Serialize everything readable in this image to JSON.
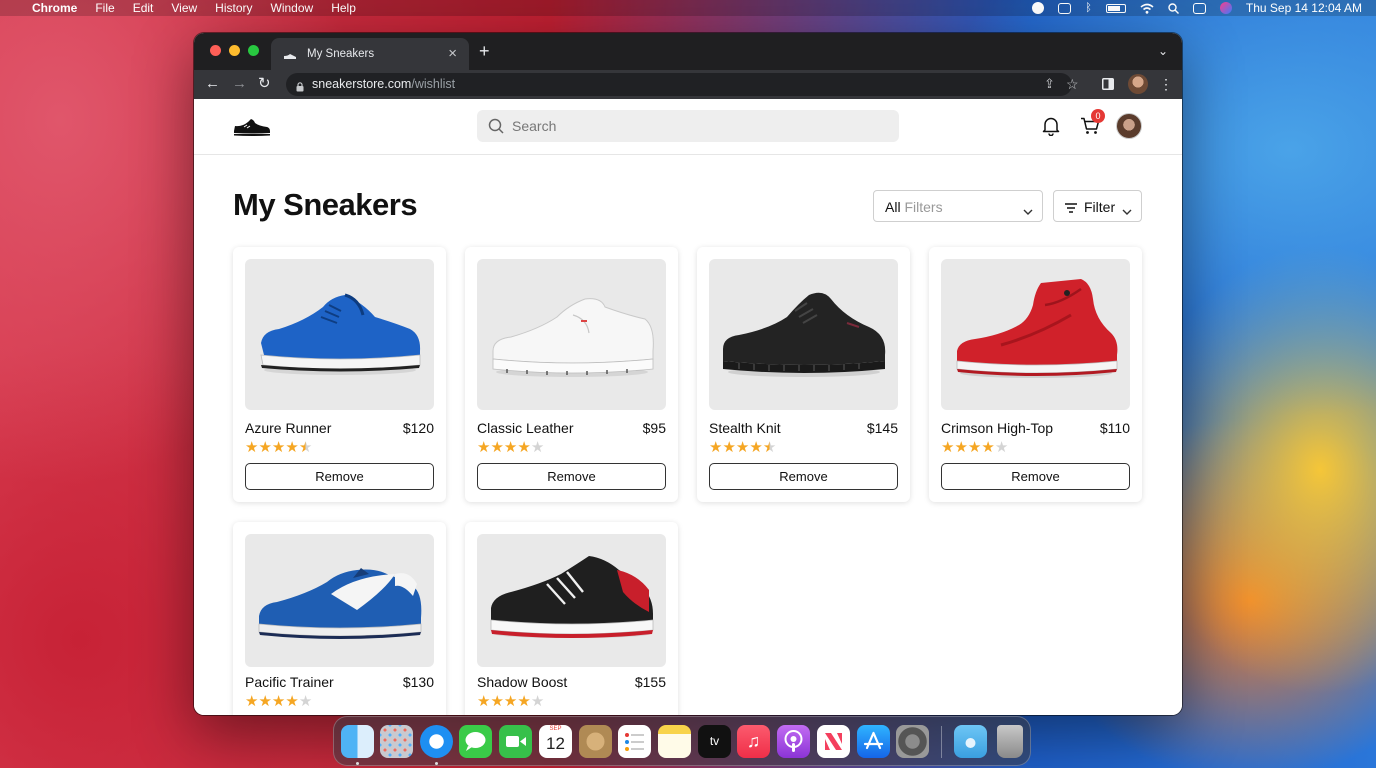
{
  "menubar": {
    "app": "Chrome",
    "menus": [
      "File",
      "Edit",
      "View",
      "History",
      "Window",
      "Help"
    ],
    "clock": "Thu Sep 14  12:04 AM"
  },
  "browser": {
    "tab_title": "My Sneakers",
    "url_host": "sneakerstore.com",
    "url_path": "/wishlist"
  },
  "header": {
    "search_placeholder": "Search",
    "cart_count": "0"
  },
  "page": {
    "title": "My Sneakers",
    "filter_select_value": "All",
    "filter_select_placeholder": "Filters",
    "filter_button_label": "Filter"
  },
  "products": [
    {
      "name": "Azure Runner",
      "price": "$120",
      "rating": 4.5,
      "remove_label": "Remove"
    },
    {
      "name": "Classic Leather",
      "price": "$95",
      "rating": 4,
      "remove_label": "Remove"
    },
    {
      "name": "Stealth Knit",
      "price": "$145",
      "rating": 4.5,
      "remove_label": "Remove"
    },
    {
      "name": "Crimson High-Top",
      "price": "$110",
      "rating": 4,
      "remove_label": "Remove"
    },
    {
      "name": "Pacific Trainer",
      "price": "$130",
      "rating": 4
    },
    {
      "name": "Shadow Boost",
      "price": "$155",
      "rating": 4
    }
  ],
  "dock": {
    "apps": [
      "finder-icon",
      "launchpad-icon",
      "safari-icon",
      "messages-icon",
      "facetime-icon",
      "calendar-icon",
      "contacts-icon",
      "reminders-icon",
      "notes-icon",
      "tv-icon",
      "music-icon",
      "podcasts-icon",
      "news-icon",
      "app-store-icon",
      "system-preferences-icon",
      "downloads-icon",
      "trash-icon"
    ],
    "calendar_month": "SEP",
    "calendar_day": "12",
    "tv_label": "tv"
  },
  "colors": {
    "star": "#f5a623",
    "badge": "#e53935"
  }
}
